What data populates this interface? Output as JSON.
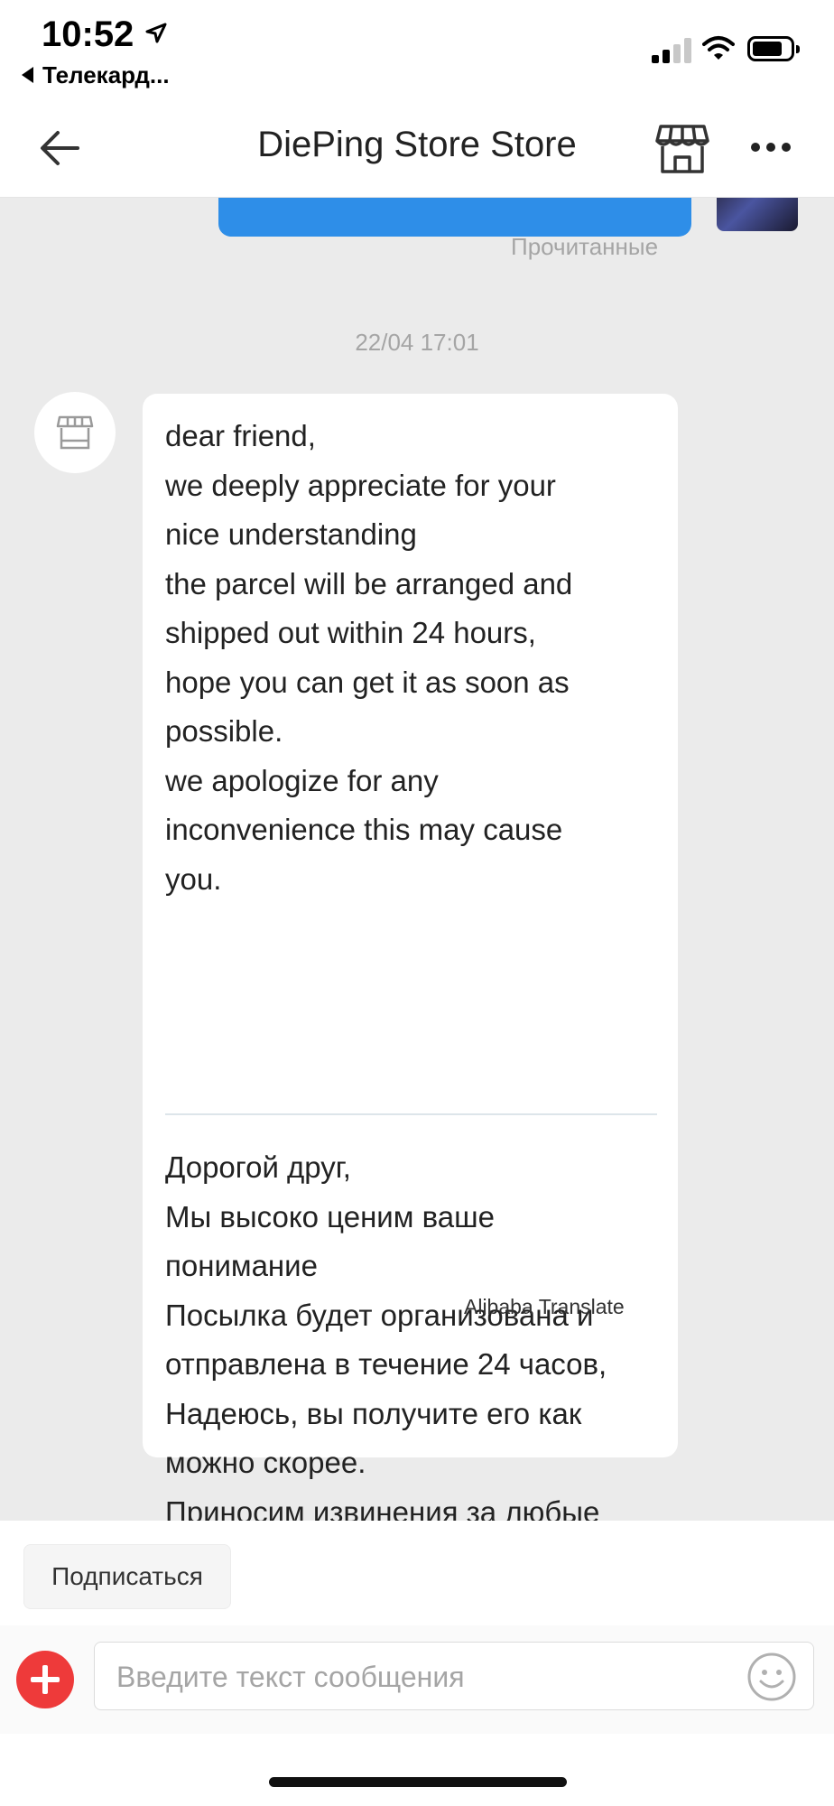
{
  "status_bar": {
    "time": "10:52",
    "back_app_label": "Телекард..."
  },
  "header": {
    "title": "DiePing Store Store",
    "icons": [
      "back-arrow-icon",
      "store-icon",
      "more-options-icon"
    ]
  },
  "chat": {
    "read_status": "Прочитанные",
    "timestamp": "22/04 17:01",
    "message": {
      "original": "dear friend,\nwe deeply appreciate for your\nnice understanding\nthe parcel will be arranged and\nshipped out within 24 hours,\nhope you can get it as soon as\npossible.\nwe apologize for any\ninconvenience this may cause\nyou.",
      "translated": "Дорогой друг,\nМы высоко ценим ваше\nпонимание\nПосылка будет организована и\nотправлена в течение 24 часов,\nНадеюсь, вы получите его как\nможно скорее.\nПриносим извинения за любые\nнеудобства, которые могут\nвозникнуть у вас.",
      "translate_credit": "Alibaba Translate"
    }
  },
  "bottom": {
    "subscribe_label": "Подписаться",
    "input_placeholder": "Введите текст сообщения",
    "input_value": ""
  },
  "colors": {
    "accent_blue": "#2e8ee8",
    "plus_red": "#ee3a3a",
    "chat_background": "#ebebeb"
  }
}
